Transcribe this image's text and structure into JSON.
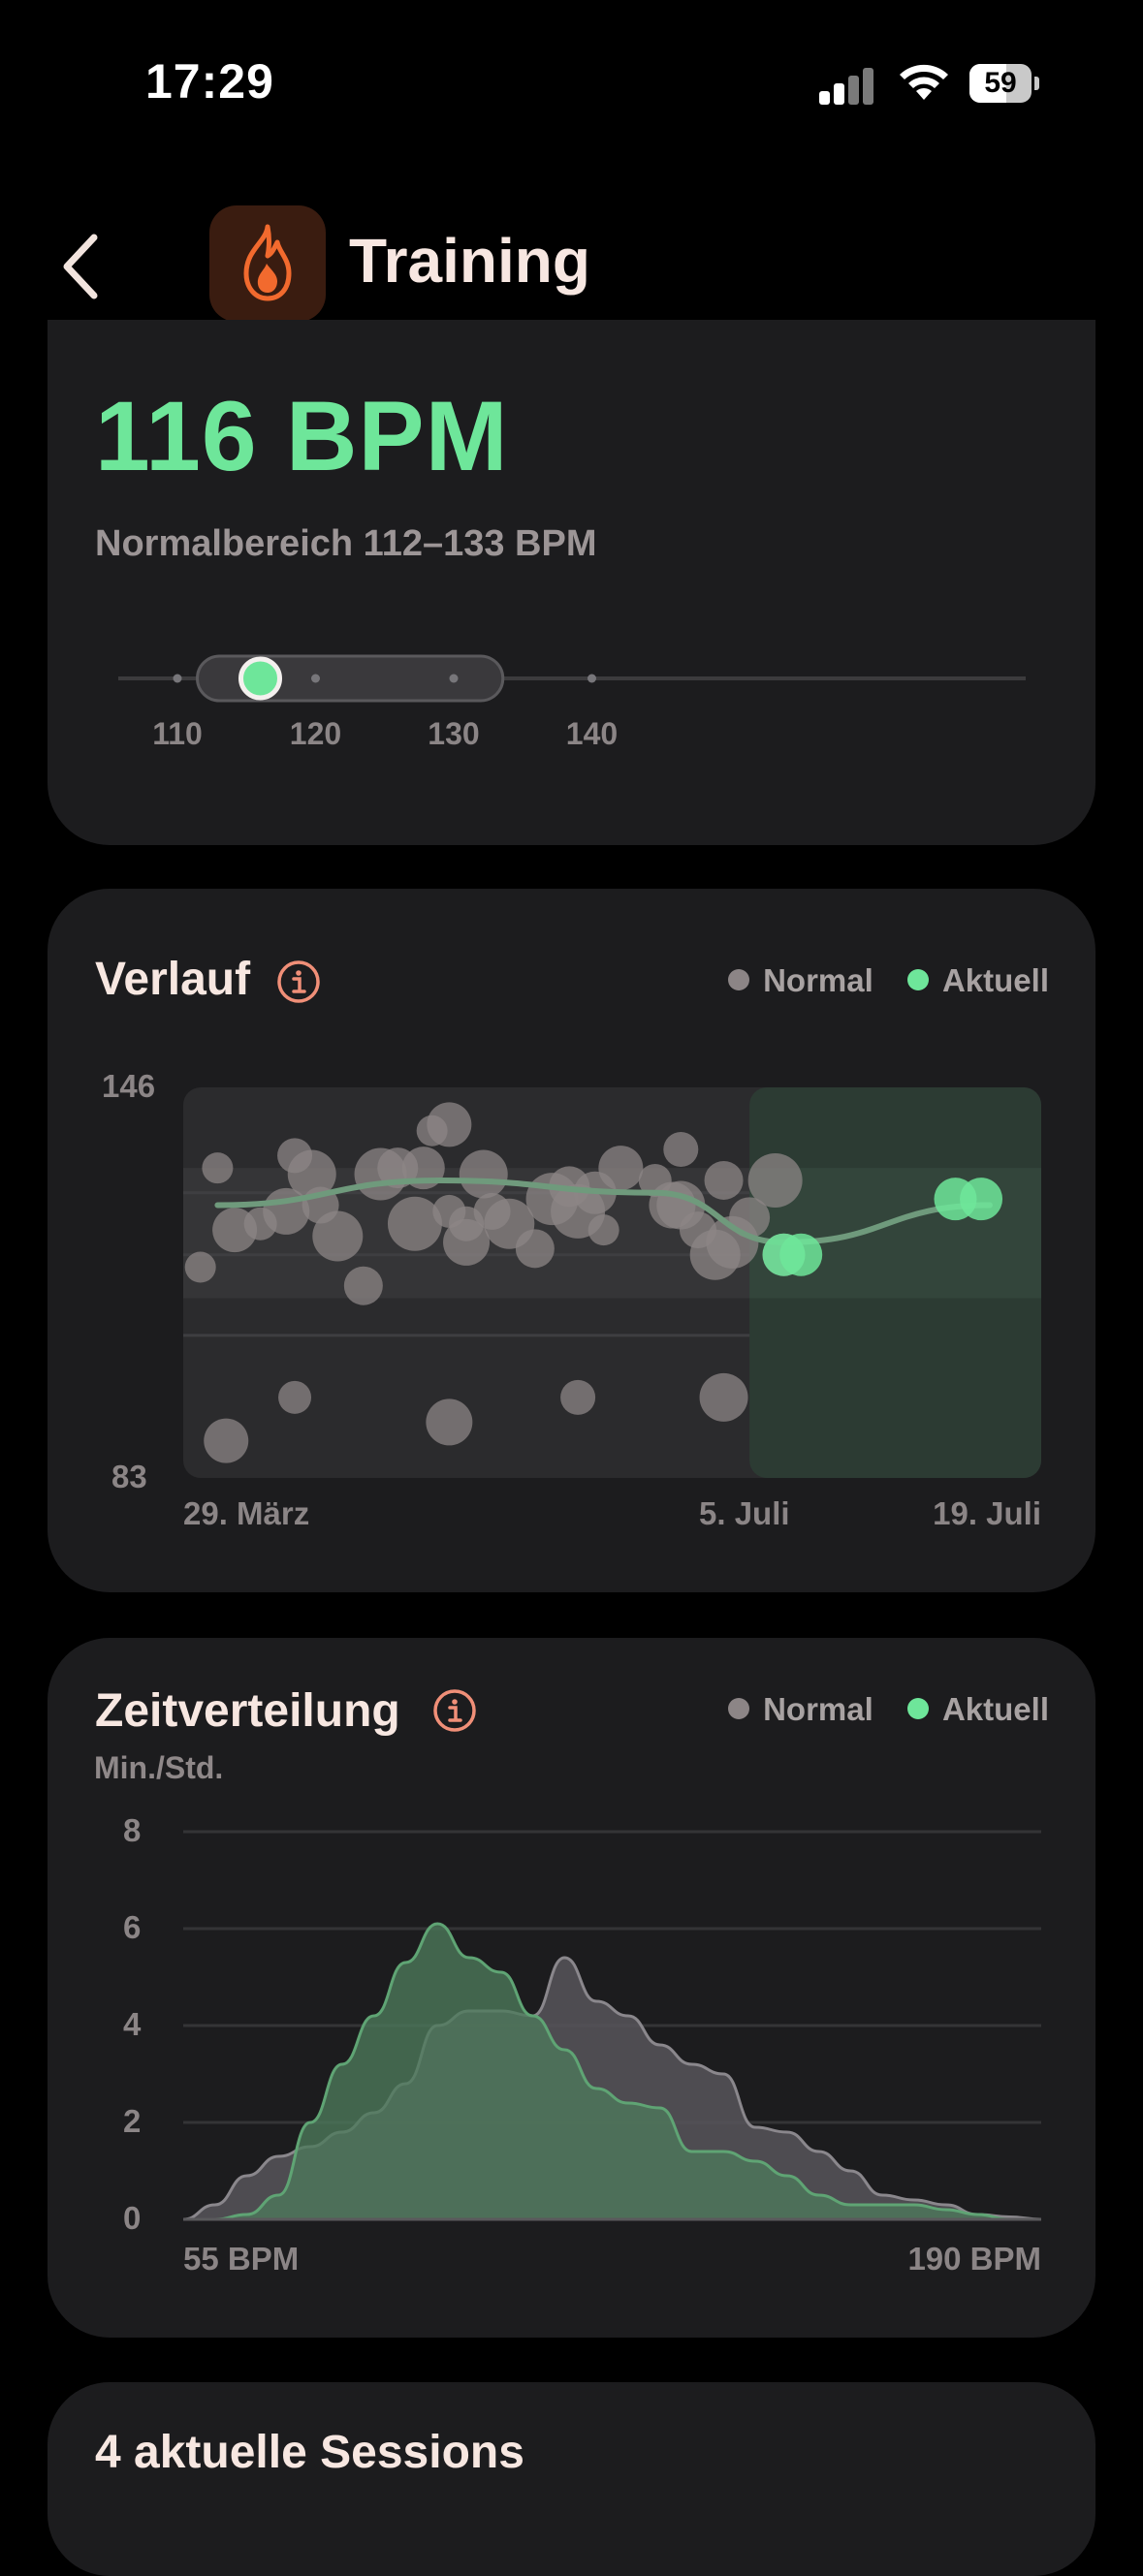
{
  "status_bar": {
    "time": "17:29",
    "battery_level": "59",
    "icons": [
      "cellular-signal-icon",
      "wifi-icon",
      "battery-icon"
    ]
  },
  "header": {
    "title": "Training",
    "back_icon": "chevron-left-icon",
    "app_icon": "flame-icon"
  },
  "heart_rate": {
    "value": "116 BPM",
    "normal_range_label": "Normalbereich 112–133 BPM",
    "slider": {
      "current": 116,
      "range_low": 112,
      "range_high": 133,
      "ticks": [
        "110",
        "120",
        "130",
        "140"
      ]
    }
  },
  "history": {
    "title": "Verlauf",
    "legend": [
      "Normal",
      "Aktuell"
    ],
    "y_max_label": "146",
    "y_min_label": "83",
    "x_labels": [
      "29. März",
      "5. Juli",
      "19. Juli"
    ]
  },
  "distribution": {
    "title": "Zeitverteilung",
    "unit": "Min./Std.",
    "legend": [
      "Normal",
      "Aktuell"
    ],
    "y_ticks": [
      "8",
      "6",
      "4",
      "2",
      "0"
    ],
    "x_start_label": "55 BPM",
    "x_end_label": "190 BPM"
  },
  "sessions": {
    "title": "4 aktuelle Sessions"
  },
  "colors": {
    "accent_green": "#6ee69a",
    "normal_gray": "#8c8586",
    "card_bg": "#1c1c1e",
    "icon_orange": "#f26a2e"
  },
  "chart_data": [
    {
      "type": "scatter",
      "title": "Verlauf",
      "ylim": [
        83,
        146
      ],
      "x_labels": [
        "29. März",
        "5. Juli",
        "19. Juli"
      ],
      "series": [
        {
          "name": "Normal",
          "points": [
            [
              0.04,
              133
            ],
            [
              0.06,
              123
            ],
            [
              0.09,
              124
            ],
            [
              0.12,
              126
            ],
            [
              0.13,
              135
            ],
            [
              0.15,
              132
            ],
            [
              0.16,
              127
            ],
            [
              0.18,
              122
            ],
            [
              0.21,
              114
            ],
            [
              0.23,
              132
            ],
            [
              0.25,
              133
            ],
            [
              0.27,
              124
            ],
            [
              0.28,
              133
            ],
            [
              0.29,
              139
            ],
            [
              0.31,
              140
            ],
            [
              0.31,
              126
            ],
            [
              0.33,
              121
            ],
            [
              0.33,
              124
            ],
            [
              0.35,
              132
            ],
            [
              0.36,
              126
            ],
            [
              0.38,
              124
            ],
            [
              0.41,
              120
            ],
            [
              0.43,
              128
            ],
            [
              0.45,
              130
            ],
            [
              0.46,
              126
            ],
            [
              0.48,
              129
            ],
            [
              0.49,
              123
            ],
            [
              0.51,
              133
            ],
            [
              0.55,
              131
            ],
            [
              0.57,
              127
            ],
            [
              0.58,
              136
            ],
            [
              0.58,
              127
            ],
            [
              0.6,
              123
            ],
            [
              0.62,
              119
            ],
            [
              0.63,
              131
            ],
            [
              0.64,
              121
            ],
            [
              0.66,
              125
            ],
            [
              0.69,
              131
            ],
            [
              0.7,
              119
            ],
            [
              0.02,
              117
            ],
            [
              0.05,
              89
            ],
            [
              0.13,
              96
            ],
            [
              0.31,
              92
            ],
            [
              0.46,
              96
            ],
            [
              0.63,
              96
            ]
          ],
          "trend": [
            [
              0.04,
              127
            ],
            [
              0.3,
              131
            ],
            [
              0.55,
              129
            ],
            [
              0.7,
              121
            ],
            [
              0.94,
              127
            ]
          ]
        },
        {
          "name": "Aktuell",
          "points": [
            [
              0.7,
              119
            ],
            [
              0.72,
              119
            ],
            [
              0.9,
              128
            ],
            [
              0.93,
              128
            ]
          ]
        }
      ]
    },
    {
      "type": "area",
      "title": "Zeitverteilung",
      "ylabel": "Min./Std.",
      "ylim": [
        0,
        8
      ],
      "x": [
        55,
        60,
        65,
        70,
        75,
        80,
        85,
        90,
        95,
        100,
        105,
        110,
        115,
        120,
        125,
        130,
        135,
        140,
        145,
        150,
        155,
        160,
        165,
        170,
        175,
        180,
        185,
        190
      ],
      "series": [
        {
          "name": "Normal",
          "values": [
            0,
            0.3,
            0.9,
            1.3,
            1.5,
            1.8,
            2.2,
            2.8,
            4.0,
            4.3,
            4.3,
            4.2,
            5.4,
            4.5,
            4.2,
            3.6,
            3.2,
            3.0,
            1.9,
            1.8,
            1.4,
            1.0,
            0.5,
            0.4,
            0.3,
            0.1,
            0.05,
            0
          ]
        },
        {
          "name": "Aktuell",
          "values": [
            0,
            0,
            0.1,
            0.5,
            2.0,
            3.2,
            4.2,
            5.3,
            6.1,
            5.4,
            5.1,
            4.2,
            3.5,
            2.7,
            2.4,
            2.3,
            1.4,
            1.4,
            1.2,
            0.9,
            0.5,
            0.3,
            0.3,
            0.3,
            0.2,
            0.1,
            0,
            0
          ]
        }
      ]
    }
  ]
}
